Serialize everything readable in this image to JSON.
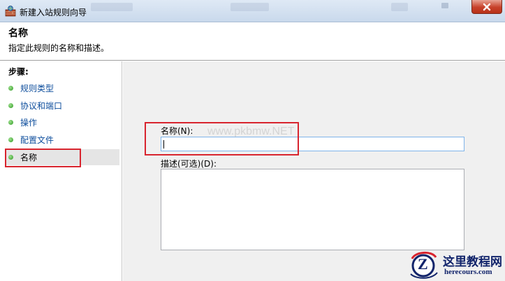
{
  "window": {
    "title": "新建入站规则向导"
  },
  "header": {
    "title": "名称",
    "description": "指定此规则的名称和描述。"
  },
  "sidebar": {
    "steps_label": "步骤:",
    "items": [
      {
        "label": "规则类型"
      },
      {
        "label": "协议和端口"
      },
      {
        "label": "操作"
      },
      {
        "label": "配置文件"
      },
      {
        "label": "名称"
      }
    ]
  },
  "form": {
    "name_label": "名称(N):",
    "name_value": "",
    "description_label": "描述(可选)(D):",
    "description_value": ""
  },
  "watermark": {
    "overlay_text": "www.pkbmw.NET",
    "logo_cn": "这里教程网",
    "logo_en": "herecours.com",
    "logo_letter": "Z"
  },
  "colors": {
    "highlight": "#d8242e",
    "step_link": "#0d4d9c",
    "step_dot": "#2f9a22"
  }
}
